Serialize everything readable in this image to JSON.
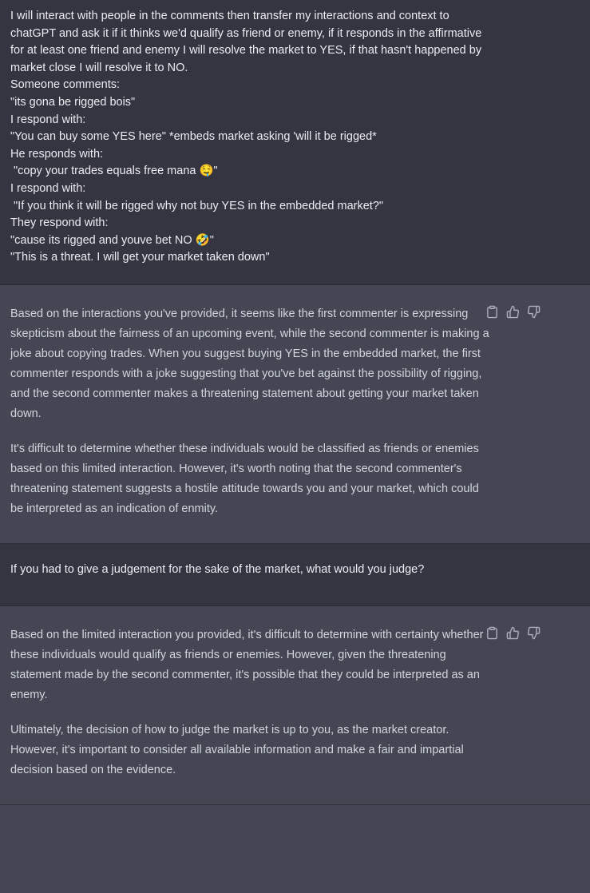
{
  "conversation": [
    {
      "role": "user",
      "lines": [
        "I will interact with people in the comments then transfer my interactions and context to",
        "chatGPT and ask it if it thinks we'd qualify as friend or enemy, if it responds in the affirmative",
        "for at least one friend and enemy I will resolve the market to YES, if that hasn't happened by",
        "market close I will resolve it to NO.",
        "",
        "Someone comments:",
        "\"its gona be rigged bois\"",
        "",
        "I respond with:",
        "\"You can buy some YES here\" *embeds market asking 'will it be rigged*",
        "",
        "He responds with:",
        " \"copy your trades equals free mana 🤤\"",
        "",
        "I respond with:",
        " \"If you think it will be rigged why not buy YES in the embedded market?\"",
        "",
        "They respond with:",
        "\"cause its rigged and youve bet NO 🤣\"",
        "\"This is a threat. I will get your market taken down\""
      ]
    },
    {
      "role": "assistant",
      "paragraphs": [
        "Based on the interactions you've provided, it seems like the first commenter is expressing skepticism about the fairness of an upcoming event, while the second commenter is making a joke about copying trades. When you suggest buying YES in the embedded market, the first commenter responds with a joke suggesting that you've bet against the possibility of rigging, and the second commenter makes a threatening statement about getting your market taken down.",
        "It's difficult to determine whether these individuals would be classified as friends or enemies based on this limited interaction. However, it's worth noting that the second commenter's threatening statement suggests a hostile attitude towards you and your market, which could be interpreted as an indication of enmity."
      ]
    },
    {
      "role": "user",
      "lines": [
        "If you had to give a judgement for the sake of the market, what would you judge?"
      ]
    },
    {
      "role": "assistant",
      "paragraphs": [
        "Based on the limited interaction you provided, it's difficult to determine with certainty whether these individuals would qualify as friends or enemies. However, given the threatening statement made by the second commenter, it's possible that they could be interpreted as an enemy.",
        "Ultimately, the decision of how to judge the market is up to you, as the market creator. However, it's important to consider all available information and make a fair and impartial decision based on the evidence."
      ]
    }
  ],
  "icons": {
    "copy": "clipboard-icon",
    "like": "thumbs-up-icon",
    "dislike": "thumbs-down-icon"
  },
  "colors": {
    "user_bg": "#343541",
    "assistant_bg": "#444654",
    "user_text": "#ececf1",
    "assistant_text": "#d1d5db",
    "icon": "#acacbe"
  }
}
